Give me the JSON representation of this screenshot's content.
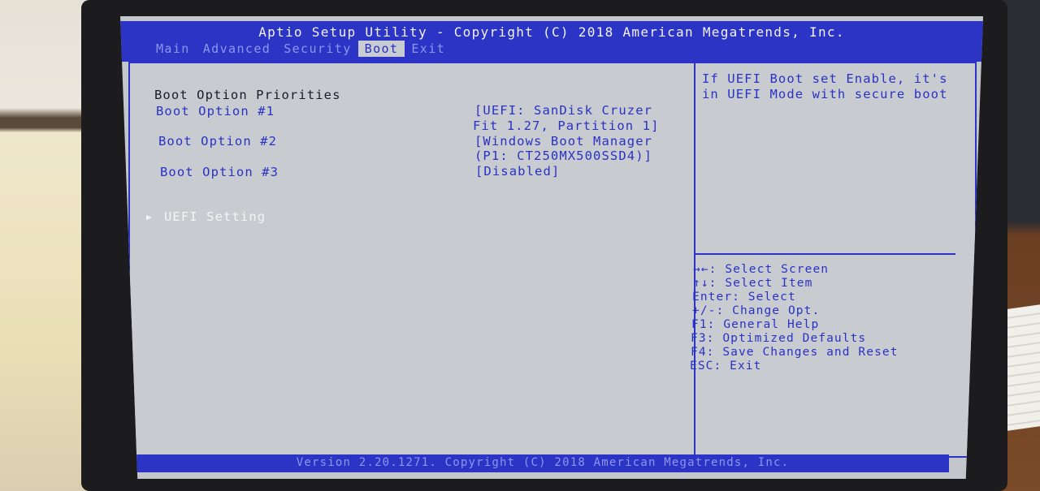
{
  "window": {
    "title": "Aptio Setup Utility - Copyright (C) 2018 American Megatrends, Inc."
  },
  "tabs": [
    {
      "label": "Main"
    },
    {
      "label": "Advanced"
    },
    {
      "label": "Security"
    },
    {
      "label": "Boot"
    },
    {
      "label": "Exit"
    }
  ],
  "active_tab": "Boot",
  "main": {
    "section_title": "Boot Option Priorities",
    "options": [
      {
        "label": "Boot Option #1",
        "value_line1": "[UEFI: SanDisk Cruzer",
        "value_line2": "Fit 1.27, Partition 1]"
      },
      {
        "label": "Boot Option #2",
        "value_line1": "[Windows Boot Manager",
        "value_line2": "(P1: CT250MX500SSD4)]"
      },
      {
        "label": "Boot Option #3",
        "value_line1": "[Disabled]"
      }
    ],
    "submenu": {
      "arrow": "▶",
      "label": "UEFI Setting"
    }
  },
  "help": {
    "description_line1": "If UEFI Boot set Enable, it's",
    "description_line2": "in UEFI Mode with secure boot",
    "keys": [
      "→←: Select Screen",
      "↑↓: Select Item",
      "Enter: Select",
      "+/-: Change Opt.",
      "F1: General Help",
      "F3: Optimized Defaults",
      "F4: Save Changes and Reset",
      "ESC: Exit"
    ]
  },
  "footer": {
    "text": "Version 2.20.1271. Copyright (C) 2018 American Megatrends, Inc."
  },
  "colors": {
    "bios_blue": "#2b34c5",
    "panel_gray": "#c8cbd0",
    "inactive_tab": "#8e96f2"
  }
}
